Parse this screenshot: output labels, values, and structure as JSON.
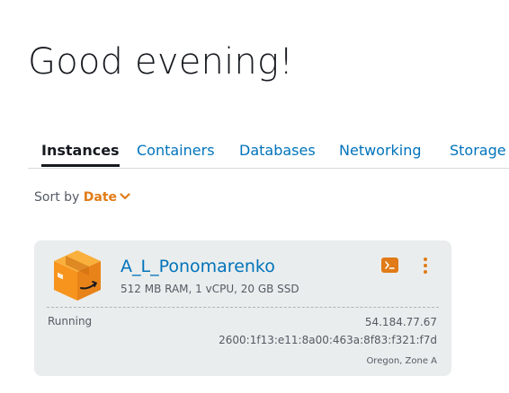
{
  "greeting": "Good evening!",
  "tabs": [
    {
      "label": "Instances",
      "active": true
    },
    {
      "label": "Containers",
      "active": false
    },
    {
      "label": "Databases",
      "active": false
    },
    {
      "label": "Networking",
      "active": false
    },
    {
      "label": "Storage",
      "active": false
    }
  ],
  "sort": {
    "label": "Sort by",
    "value": "Date",
    "icon": "chevron-down-icon"
  },
  "instance": {
    "name": "A_L_Ponomarenko",
    "spec": "512 MB RAM, 1 vCPU, 20 GB SSD",
    "status": "Running",
    "ipv4": "54.184.77.67",
    "ipv6": "2600:1f13:e11:8a00:463a:8f83:f321:f7d",
    "region": "Oregon, Zone A",
    "icon": "amazon-box-icon",
    "connect_icon": "terminal-icon",
    "menu_icon": "kebab-menu-icon"
  },
  "colors": {
    "accent": "#e07b17",
    "link": "#0073bb",
    "text": "#16191f",
    "muted": "#545b64",
    "card_bg": "#eaeded"
  }
}
